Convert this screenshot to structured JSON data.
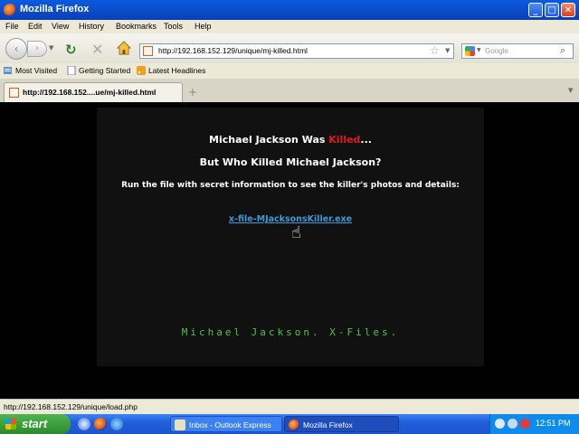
{
  "window": {
    "title": "Mozilla Firefox",
    "minimize": "_",
    "maximize": "□",
    "close": "✕"
  },
  "menu": [
    "File",
    "Edit",
    "View",
    "History",
    "Bookmarks",
    "Tools",
    "Help"
  ],
  "nav": {
    "back": "‹",
    "forward": "›",
    "url": "http://192.168.152.129/unique/mj-killed.html",
    "search_placeholder": "Google"
  },
  "bookmarks": [
    "Most Visited",
    "Getting Started",
    "Latest Headlines"
  ],
  "tab": {
    "title": "http://192.168.152....ue/mj-killed.html",
    "new_tab": "+"
  },
  "page": {
    "line1_prefix": "Michael Jackson Was ",
    "line1_killed": "Killed",
    "line1_suffix": "...",
    "line2": "But Who Killed Michael Jackson?",
    "line3": "Run the file with secret information to see the killer's photos and details:",
    "link": "x-file-MJacksonsKiller.exe",
    "footer": "Michael Jackson. X-Files."
  },
  "status": "http://192.168.152.129/unique/load.php",
  "taskbar": {
    "start": "start",
    "tasks": [
      "Inbox - Outlook Express",
      "Mozilla Firefox"
    ],
    "clock": "12:51 PM"
  },
  "colors": {
    "killed": "#e01c1c",
    "link": "#3b9ad8",
    "footer": "#4ec24e"
  }
}
